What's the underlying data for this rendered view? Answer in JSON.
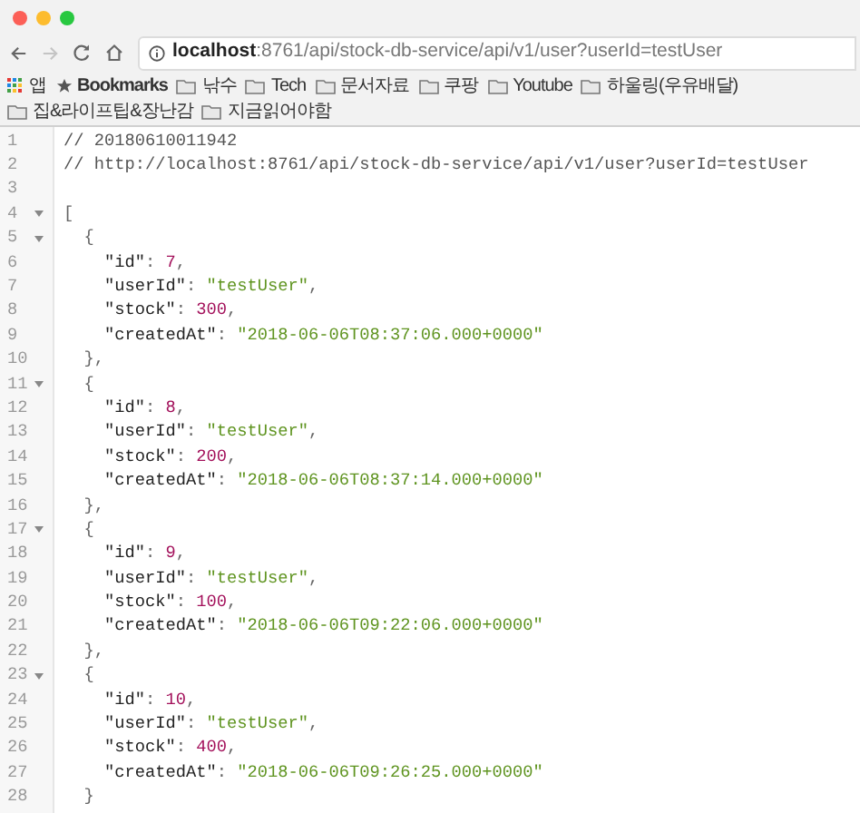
{
  "address_bar": {
    "url": "**localhost**:8761/api/stock-db-service/api/v1/user?userId=testUser"
  },
  "bookmarks": [
    {
      "kind": "apps",
      "label": "앱"
    },
    {
      "kind": "star",
      "label": "Bookmarks"
    },
    {
      "kind": "folder",
      "label": "낚수"
    },
    {
      "kind": "folder",
      "label": "Tech"
    },
    {
      "kind": "folder",
      "label": "문서자료"
    },
    {
      "kind": "folder",
      "label": "쿠팡"
    },
    {
      "kind": "folder",
      "label": "Youtube"
    },
    {
      "kind": "folder",
      "label": "하울링(우유배달)"
    },
    {
      "kind": "folder",
      "label": "집&라이프팁&장난감"
    },
    {
      "kind": "folder",
      "label": "지금읽어야함"
    }
  ],
  "code_lines": [
    {
      "number": "1",
      "segments": [
        {
          "kind": "comment",
          "text": "// 20180610011942"
        }
      ]
    },
    {
      "number": "2",
      "segments": [
        {
          "kind": "comment",
          "text": "// http://localhost:8761/api/stock-db-service/api/v1/user?userId=testUser"
        }
      ]
    },
    {
      "number": "3"
    },
    {
      "number": "4",
      "expanded": true,
      "segments": [
        {
          "kind": "punct",
          "text": "["
        }
      ]
    },
    {
      "number": "5",
      "expanded": true,
      "segments": [
        {
          "kind": "punct",
          "text": "  {"
        }
      ]
    },
    {
      "number": "6",
      "segments": [
        {
          "kind": "key",
          "text": "    \"id\""
        },
        {
          "kind": "punct",
          "text": ": "
        },
        {
          "kind": "number",
          "text": "7"
        },
        {
          "kind": "punct",
          "text": ","
        }
      ]
    },
    {
      "number": "7",
      "segments": [
        {
          "kind": "key",
          "text": "    \"userId\""
        },
        {
          "kind": "punct",
          "text": ": "
        },
        {
          "kind": "string",
          "text": "\"testUser\""
        },
        {
          "kind": "punct",
          "text": ","
        }
      ]
    },
    {
      "number": "8",
      "segments": [
        {
          "kind": "key",
          "text": "    \"stock\""
        },
        {
          "kind": "punct",
          "text": ": "
        },
        {
          "kind": "number",
          "text": "300"
        },
        {
          "kind": "punct",
          "text": ","
        }
      ]
    },
    {
      "number": "9",
      "segments": [
        {
          "kind": "key",
          "text": "    \"createdAt\""
        },
        {
          "kind": "punct",
          "text": ": "
        },
        {
          "kind": "string",
          "text": "\"2018-06-06T08:37:06.000+0000\""
        }
      ]
    },
    {
      "number": "10",
      "segments": [
        {
          "kind": "punct",
          "text": "  },"
        }
      ]
    },
    {
      "number": "11",
      "expanded": true,
      "segments": [
        {
          "kind": "punct",
          "text": "  {"
        }
      ]
    },
    {
      "number": "12",
      "segments": [
        {
          "kind": "key",
          "text": "    \"id\""
        },
        {
          "kind": "punct",
          "text": ": "
        },
        {
          "kind": "number",
          "text": "8"
        },
        {
          "kind": "punct",
          "text": ","
        }
      ]
    },
    {
      "number": "13",
      "segments": [
        {
          "kind": "key",
          "text": "    \"userId\""
        },
        {
          "kind": "punct",
          "text": ": "
        },
        {
          "kind": "string",
          "text": "\"testUser\""
        },
        {
          "kind": "punct",
          "text": ","
        }
      ]
    },
    {
      "number": "14",
      "segments": [
        {
          "kind": "key",
          "text": "    \"stock\""
        },
        {
          "kind": "punct",
          "text": ": "
        },
        {
          "kind": "number",
          "text": "200"
        },
        {
          "kind": "punct",
          "text": ","
        }
      ]
    },
    {
      "number": "15",
      "segments": [
        {
          "kind": "key",
          "text": "    \"createdAt\""
        },
        {
          "kind": "punct",
          "text": ": "
        },
        {
          "kind": "string",
          "text": "\"2018-06-06T08:37:14.000+0000\""
        }
      ]
    },
    {
      "number": "16",
      "segments": [
        {
          "kind": "punct",
          "text": "  },"
        }
      ]
    },
    {
      "number": "17",
      "expanded": true,
      "segments": [
        {
          "kind": "punct",
          "text": "  {"
        }
      ]
    },
    {
      "number": "18",
      "segments": [
        {
          "kind": "key",
          "text": "    \"id\""
        },
        {
          "kind": "punct",
          "text": ": "
        },
        {
          "kind": "number",
          "text": "9"
        },
        {
          "kind": "punct",
          "text": ","
        }
      ]
    },
    {
      "number": "19",
      "segments": [
        {
          "kind": "key",
          "text": "    \"userId\""
        },
        {
          "kind": "punct",
          "text": ": "
        },
        {
          "kind": "string",
          "text": "\"testUser\""
        },
        {
          "kind": "punct",
          "text": ","
        }
      ]
    },
    {
      "number": "20",
      "segments": [
        {
          "kind": "key",
          "text": "    \"stock\""
        },
        {
          "kind": "punct",
          "text": ": "
        },
        {
          "kind": "number",
          "text": "100"
        },
        {
          "kind": "punct",
          "text": ","
        }
      ]
    },
    {
      "number": "21",
      "segments": [
        {
          "kind": "key",
          "text": "    \"createdAt\""
        },
        {
          "kind": "punct",
          "text": ": "
        },
        {
          "kind": "string",
          "text": "\"2018-06-06T09:22:06.000+0000\""
        }
      ]
    },
    {
      "number": "22",
      "segments": [
        {
          "kind": "punct",
          "text": "  },"
        }
      ]
    },
    {
      "number": "23",
      "expanded": true,
      "segments": [
        {
          "kind": "punct",
          "text": "  {"
        }
      ]
    },
    {
      "number": "24",
      "segments": [
        {
          "kind": "key",
          "text": "    \"id\""
        },
        {
          "kind": "punct",
          "text": ": "
        },
        {
          "kind": "number",
          "text": "10"
        },
        {
          "kind": "punct",
          "text": ","
        }
      ]
    },
    {
      "number": "25",
      "segments": [
        {
          "kind": "key",
          "text": "    \"userId\""
        },
        {
          "kind": "punct",
          "text": ": "
        },
        {
          "kind": "string",
          "text": "\"testUser\""
        },
        {
          "kind": "punct",
          "text": ","
        }
      ]
    },
    {
      "number": "26",
      "segments": [
        {
          "kind": "key",
          "text": "    \"stock\""
        },
        {
          "kind": "punct",
          "text": ": "
        },
        {
          "kind": "number",
          "text": "400"
        },
        {
          "kind": "punct",
          "text": ","
        }
      ]
    },
    {
      "number": "27",
      "segments": [
        {
          "kind": "key",
          "text": "    \"createdAt\""
        },
        {
          "kind": "punct",
          "text": ": "
        },
        {
          "kind": "string",
          "text": "\"2018-06-06T09:26:25.000+0000\""
        }
      ]
    },
    {
      "number": "28",
      "segments": [
        {
          "kind": "punct",
          "text": "  }"
        }
      ]
    }
  ]
}
